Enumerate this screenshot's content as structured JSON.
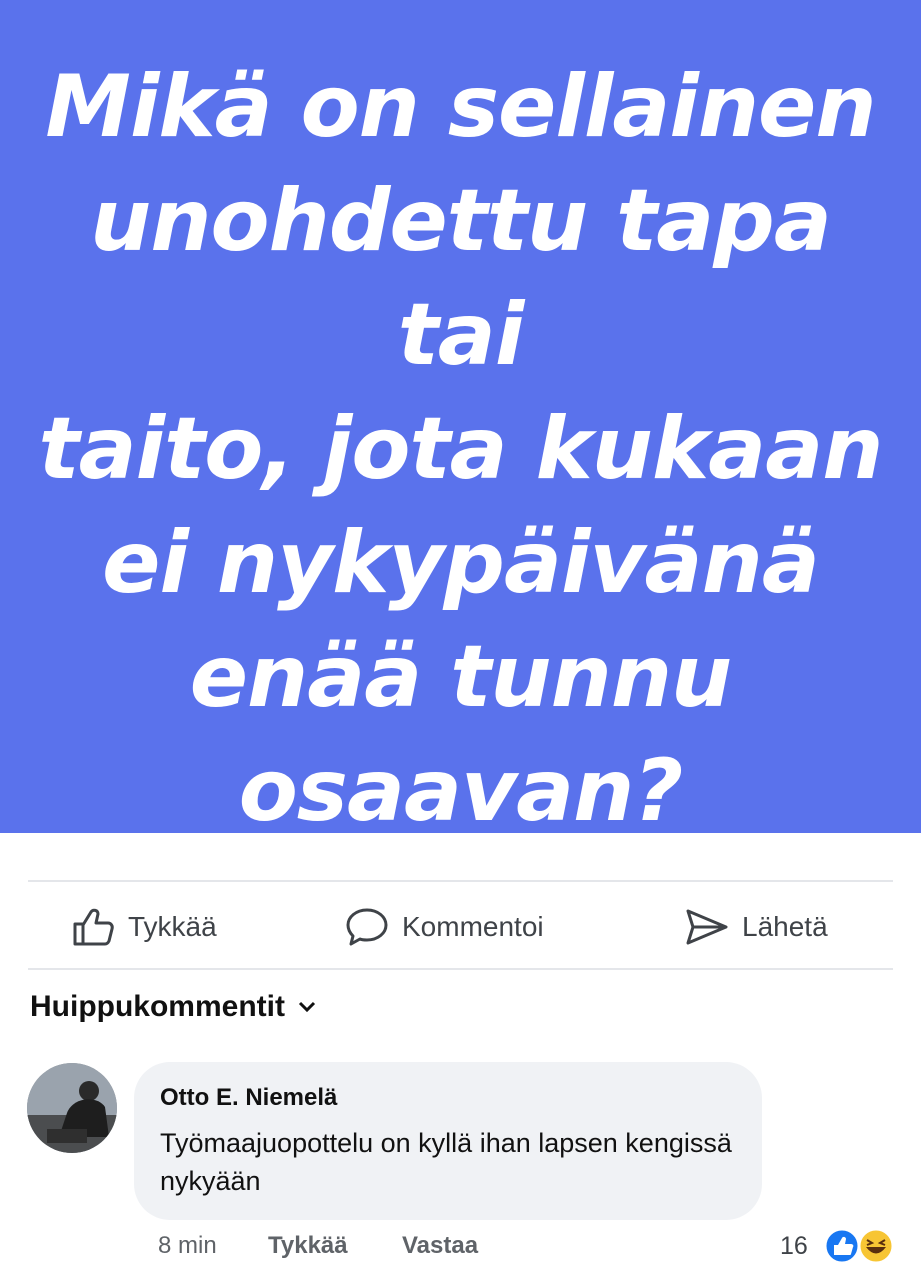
{
  "post": {
    "banner_lines": [
      "Mikä on sellainen",
      "unohdettu tapa tai",
      "taito, jota kukaan",
      "ei nykypäivänä",
      "enää tunnu",
      "osaavan?"
    ],
    "banner_color": "#5a72ec"
  },
  "actions": {
    "like_label": "Tykkää",
    "comment_label": "Kommentoi",
    "share_label": "Lähetä"
  },
  "comments_section": {
    "title": "Huippukommentit"
  },
  "comment": {
    "author": "Otto E. Niemelä",
    "text": "Työmaajuopottelu on kyllä ihan lapsen kengissä nykyään",
    "time": "8 min",
    "like_label": "Tykkää",
    "reply_label": "Vastaa",
    "reaction_count": "16",
    "reactions": [
      "like-icon",
      "haha-icon"
    ]
  }
}
